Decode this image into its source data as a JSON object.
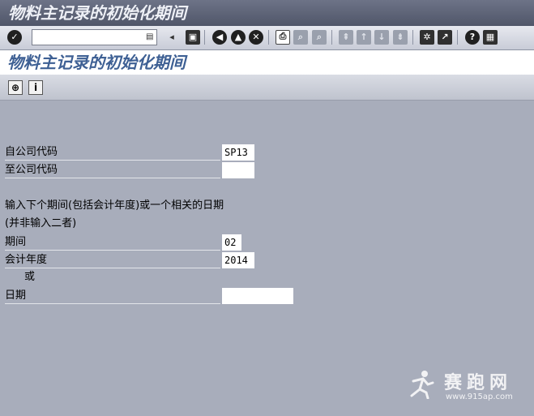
{
  "window": {
    "title": "物料主记录的初始化期间"
  },
  "toolbar": {
    "command_value": "",
    "buttons": [
      "check-icon",
      "back-icon",
      "save-icon",
      "back-nav-icon",
      "exit-icon",
      "cancel-icon",
      "print-icon",
      "find-icon",
      "find-next-icon",
      "first-page-icon",
      "prev-page-icon",
      "next-page-icon",
      "last-page-icon",
      "new-session-icon",
      "shortcut-icon",
      "help-icon",
      "layout-icon"
    ]
  },
  "screen": {
    "title": "物料主记录的初始化期间"
  },
  "app_toolbar": {
    "buttons": [
      "execute-icon",
      "info-icon"
    ]
  },
  "form": {
    "from_company_label": "自公司代码",
    "from_company_value": "SP13",
    "to_company_label": "至公司代码",
    "to_company_value": "",
    "instruction_line1": "输入下个期间(包括会计年度)或一个相关的日期",
    "instruction_line2": "(并非输入二者)",
    "period_label": "期间",
    "period_value": "02",
    "fiscal_year_label": "会计年度",
    "fiscal_year_value": "2014",
    "or_text": "或",
    "date_label": "日期",
    "date_value": ""
  },
  "watermark": {
    "text": "赛跑网",
    "url": "www.915ap.com"
  }
}
